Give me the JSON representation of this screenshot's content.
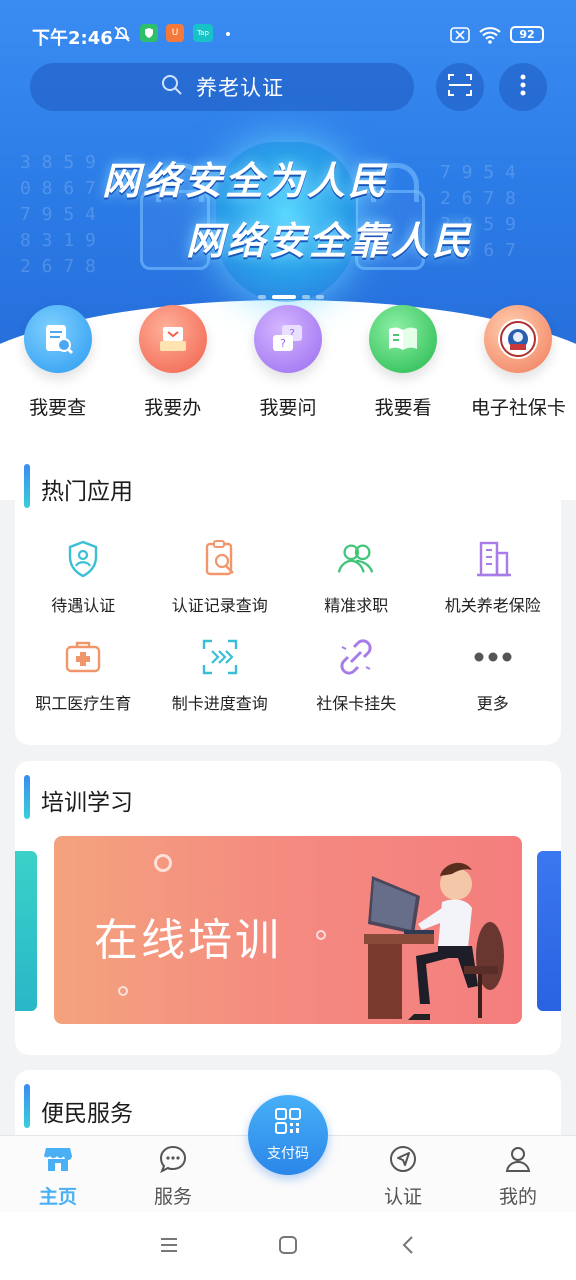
{
  "status_bar": {
    "time": "下午2:46",
    "battery": "92",
    "app_badges": [
      "U",
      "Tap"
    ]
  },
  "search": {
    "placeholder": "养老认证"
  },
  "banner": {
    "line1": "网络安全为人民",
    "line2": "网络安全靠人民",
    "digits": [
      "3 8 5 9",
      "0 8 6 7",
      "7 9 5 4",
      "8 3 1 9",
      "2 6 7 8"
    ]
  },
  "quick_actions": [
    {
      "label": "我要查",
      "icon": "search-doc-icon",
      "color": "#3aa6f4"
    },
    {
      "label": "我要办",
      "icon": "inbox-tray-icon",
      "color": "#f5705a"
    },
    {
      "label": "我要问",
      "icon": "question-chat-icon",
      "color": "#a07cf0"
    },
    {
      "label": "我要看",
      "icon": "open-book-icon",
      "color": "#2fc35c"
    },
    {
      "label": "电子社保卡",
      "icon": "social-security-seal-icon",
      "color": "#f06a5a"
    }
  ],
  "hot_apps": {
    "title": "热门应用",
    "items": [
      {
        "label": "待遇认证",
        "icon": "shield-user-icon"
      },
      {
        "label": "认证记录查询",
        "icon": "record-search-icon"
      },
      {
        "label": "精准求职",
        "icon": "users-icon"
      },
      {
        "label": "机关养老保险",
        "icon": "building-icon"
      },
      {
        "label": "职工医疗生育",
        "icon": "medical-kit-icon"
      },
      {
        "label": "制卡进度查询",
        "icon": "progress-arrows-icon"
      },
      {
        "label": "社保卡挂失",
        "icon": "broken-link-icon"
      },
      {
        "label": "更多",
        "icon": "more-dots-icon"
      }
    ]
  },
  "training": {
    "title": "培训学习",
    "banner_text": "在线培训"
  },
  "services": {
    "title": "便民服务"
  },
  "bottom_nav": {
    "items": [
      {
        "label": "主页",
        "icon": "store-icon",
        "active": true
      },
      {
        "label": "服务",
        "icon": "chat-bubble-icon",
        "active": false
      },
      {
        "label": "认证",
        "icon": "navigation-icon",
        "active": false
      },
      {
        "label": "我的",
        "icon": "user-icon",
        "active": false
      }
    ],
    "pay_label": "支付码"
  },
  "colors": {
    "primary": "#2b7be6",
    "active_tab": "#4ab0f5",
    "icon_teal": "#3bbfd6",
    "icon_orange": "#f0966a",
    "icon_green": "#42c57a",
    "icon_purple": "#a87ce8"
  }
}
